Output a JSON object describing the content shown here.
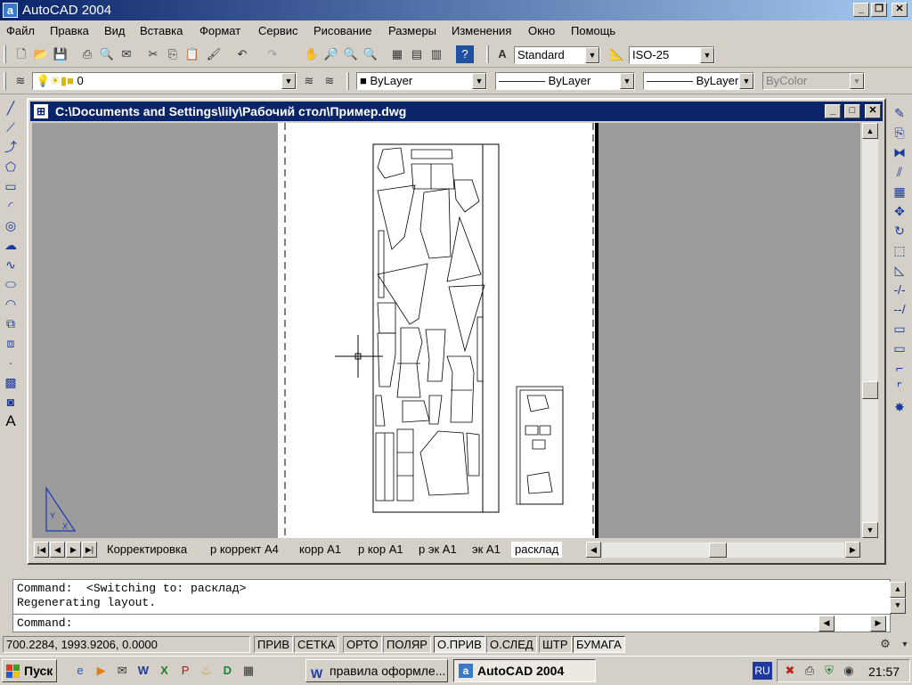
{
  "app": {
    "title": "AutoCAD 2004",
    "icon": "autocad-icon"
  },
  "caption_buttons": {
    "minimize": "_",
    "restore": "❐",
    "close": "✕"
  },
  "menu": [
    "Файл",
    "Правка",
    "Вид",
    "Вставка",
    "Формат",
    "Сервис",
    "Рисование",
    "Размеры",
    "Изменения",
    "Окно",
    "Помощь"
  ],
  "toolbar": {
    "text_style": "Standard",
    "dim_style": "ISO-25",
    "layer": "0",
    "color": "ByLayer",
    "linetype": "ByLayer",
    "lineweight": "ByLayer",
    "plotstyle": "ByColor"
  },
  "document": {
    "title": "C:\\Documents and Settings\\lily\\Рабочий стол\\Пример.dwg",
    "tabs": [
      "Корректировка",
      "р коррект А4",
      "корр А1",
      "р кор А1",
      "р эк А1",
      "эк А1",
      "расклад"
    ],
    "active_tab": "расклад"
  },
  "command": {
    "line1": "Command:  <Switching to: расклад>",
    "line2": "Regenerating layout.",
    "prompt": "Command:"
  },
  "status": {
    "coords": "700.2284, 1993.9206, 0.0000",
    "toggles": [
      "ПРИВ",
      "СЕТКА",
      "ОРТО",
      "ПОЛЯР",
      "О.ПРИВ",
      "О.СЛЕД",
      "ШТР",
      "БУМАГА"
    ],
    "pressed": [
      "О.ПРИВ",
      "БУМАГА"
    ]
  },
  "taskbar": {
    "start": "Пуск",
    "tasks": [
      "правила оформле...",
      "AutoCAD 2004"
    ],
    "active_task": "AutoCAD 2004",
    "lang": "RU",
    "clock": "21:57"
  },
  "colors": {
    "titlebar": "#0a246a",
    "face": "#d4d0c8",
    "canvas": "#9b9b9b"
  }
}
